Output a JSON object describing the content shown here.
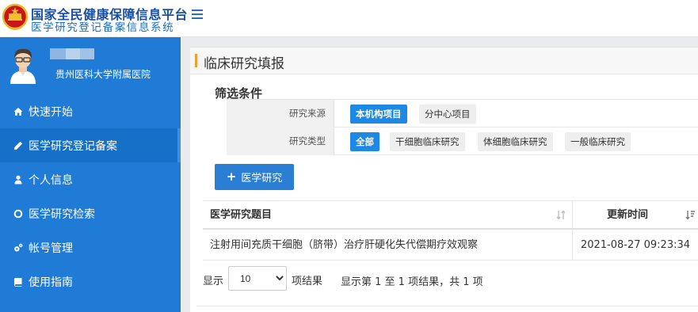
{
  "header": {
    "title_main": "国家全民健康保障信息平台",
    "title_sub": "医学研究登记备案信息系统"
  },
  "user": {
    "organization": "贵州医科大学附属医院"
  },
  "sidebar": {
    "items": [
      {
        "label": "快速开始",
        "icon": "home-icon"
      },
      {
        "label": "医学研究登记备案",
        "icon": "pencil-icon"
      },
      {
        "label": "个人信息",
        "icon": "user-icon"
      },
      {
        "label": "医学研究检索",
        "icon": "circle-icon"
      },
      {
        "label": "帐号管理",
        "icon": "gears-icon"
      },
      {
        "label": "使用指南",
        "icon": "book-icon"
      }
    ],
    "active_index": 1
  },
  "panel": {
    "title": "临床研究填报"
  },
  "filter": {
    "title": "筛选条件",
    "source_label": "研究来源",
    "source_options": [
      "本机构项目",
      "分中心项目"
    ],
    "type_label": "研究类型",
    "type_options": [
      "全部",
      "干细胞临床研究",
      "体细胞临床研究",
      "一般临床研究"
    ]
  },
  "actions": {
    "add_label": "医学研究"
  },
  "table": {
    "columns": [
      "医学研究题目",
      "更新时间"
    ],
    "rows": [
      {
        "title": "注射用间充质干细胞（脐带）治疗肝硬化失代偿期疗效观察",
        "updated": "2021-08-27 09:23:34"
      }
    ]
  },
  "pager": {
    "show_label": "显示",
    "page_size": "10",
    "suffix_label": "项结果",
    "info": "显示第 1 至 1 项结果，共 1 项"
  },
  "colors": {
    "sidebar_bg": "#1f7bd6",
    "accent": "#1e88e5",
    "panel_bar": "#f0a030"
  }
}
